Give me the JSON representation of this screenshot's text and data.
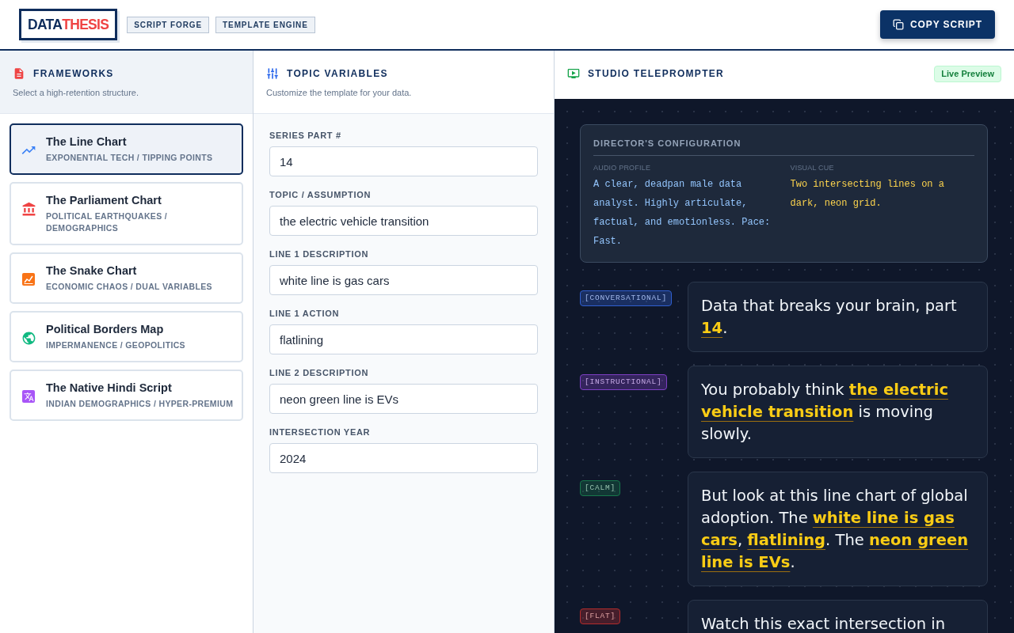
{
  "header": {
    "logo": {
      "primary": "DATA",
      "accent": "THESIS"
    },
    "tags": [
      "SCRIPT FORGE",
      "TEMPLATE ENGINE"
    ],
    "copy_button": "COPY SCRIPT"
  },
  "frameworks": {
    "title": "FRAMEWORKS",
    "subtitle": "Select a high-retention structure.",
    "items": [
      {
        "title": "The Line Chart",
        "subtitle": "EXPONENTIAL TECH / TIPPING POINTS",
        "color": "#3b82f6",
        "selected": true
      },
      {
        "title": "The Parliament Chart",
        "subtitle": "POLITICAL EARTHQUAKES / DEMOGRAPHICS",
        "color": "#ef4444",
        "selected": false
      },
      {
        "title": "The Snake Chart",
        "subtitle": "ECONOMIC CHAOS / DUAL VARIABLES",
        "color": "#f97316",
        "selected": false
      },
      {
        "title": "Political Borders Map",
        "subtitle": "IMPERMANENCE / GEOPOLITICS",
        "color": "#10b981",
        "selected": false
      },
      {
        "title": "The Native Hindi Script",
        "subtitle": "INDIAN DEMOGRAPHICS / HYPER-PREMIUM",
        "color": "#a855f7",
        "selected": false
      }
    ]
  },
  "variables": {
    "title": "TOPIC VARIABLES",
    "subtitle": "Customize the template for your data.",
    "fields": [
      {
        "label": "SERIES PART #",
        "value": "14"
      },
      {
        "label": "TOPIC / ASSUMPTION",
        "value": "the electric vehicle transition"
      },
      {
        "label": "LINE 1 DESCRIPTION",
        "value": "white line is gas cars"
      },
      {
        "label": "LINE 1 ACTION",
        "value": "flatlining"
      },
      {
        "label": "LINE 2 DESCRIPTION",
        "value": "neon green line is EVs"
      },
      {
        "label": "INTERSECTION YEAR",
        "value": "2024"
      }
    ]
  },
  "teleprompter": {
    "title": "STUDIO TELEPROMPTER",
    "badge": "Live Preview",
    "director": {
      "title": "DIRECTOR'S CONFIGURATION",
      "audio_label": "AUDIO PROFILE",
      "audio": "A clear, deadpan male data analyst. Highly articulate, factual, and emotionless. Pace: Fast.",
      "visual_label": "VISUAL CUE",
      "visual": "Two intersecting lines on a dark, neon grid."
    },
    "lines": [
      {
        "tag": "[CONVERSATIONAL]",
        "color": "#2f5fd0",
        "text": "Data that breaks your brain, part **14**."
      },
      {
        "tag": "[INSTRUCTIONAL]",
        "color": "#7e3fc4",
        "text": "You probably think **the electric vehicle transition** is moving slowly."
      },
      {
        "tag": "[CALM]",
        "color": "#17784c",
        "text": "But look at this line chart of global adoption. The **white line is gas cars**, **flatlining**. The **neon green line is EVs**."
      },
      {
        "tag": "[FLAT]",
        "color": "#b42c2c",
        "text": "Watch this exact intersection in"
      }
    ]
  }
}
